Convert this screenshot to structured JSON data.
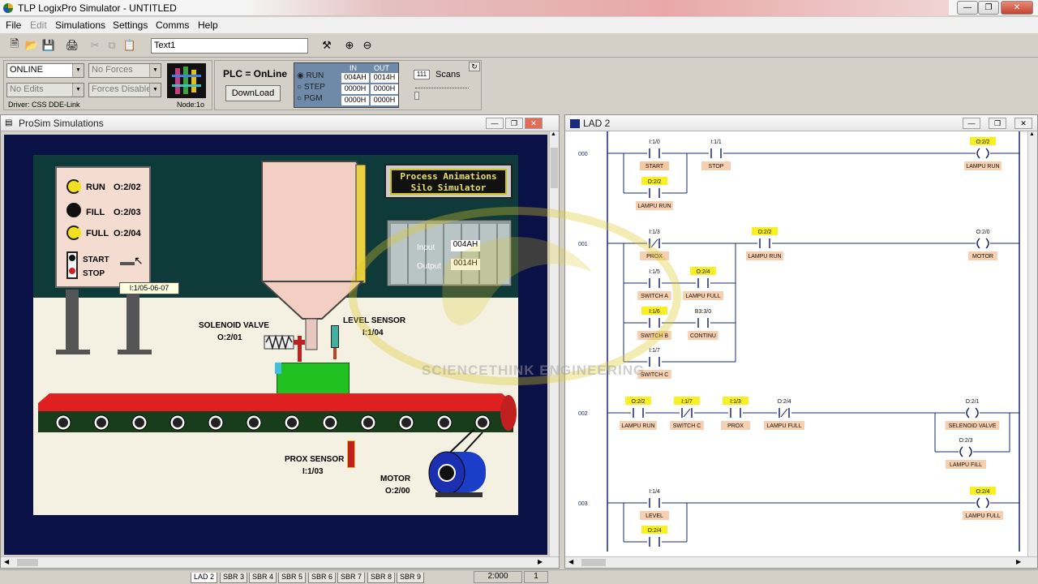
{
  "window": {
    "title": "TLP LogixPro Simulator  -  UNTITLED"
  },
  "menu": [
    "File",
    "Edit",
    "Simulations",
    "Settings",
    "Comms",
    "Help"
  ],
  "toolbar": {
    "text_field": "Text1"
  },
  "controls": {
    "mode": "ONLINE",
    "forces": "No Forces",
    "edits": "No Edits",
    "forces_state": "Forces Disabled",
    "driver": "Driver: CSS DDE-Link",
    "node": "Node:1o",
    "plc_status": "PLC = OnLine",
    "download": "DownLoad",
    "modes": [
      "RUN",
      "STEP",
      "PGM"
    ],
    "io_headers": [
      "IN",
      "OUT"
    ],
    "io_rows": [
      [
        "004AH",
        "0014H"
      ],
      [
        "0000H",
        "0000H"
      ],
      [
        "0000H",
        "0000H"
      ]
    ],
    "scans_value": "111",
    "scans_label": "Scans"
  },
  "prosim": {
    "title": "ProSim Simulations",
    "banner": [
      "Process Animations",
      "Silo Simulator"
    ],
    "plc_input_label": "Input",
    "plc_input": "004AH",
    "plc_output_label": "Output",
    "plc_output": "0014H",
    "lights": [
      {
        "label": "RUN",
        "addr": "O:2/02"
      },
      {
        "label": "FILL",
        "addr": "O:2/03"
      },
      {
        "label": "FULL",
        "addr": "O:2/04"
      }
    ],
    "start": "START",
    "stop": "STOP",
    "tooltip": "I:1/05-06-07",
    "solenoid": {
      "label": "SOLENOID VALVE",
      "addr": "O:2/01"
    },
    "level": {
      "label": "LEVEL SENSOR",
      "addr": "I:1/04"
    },
    "prox": {
      "label": "PROX SENSOR",
      "addr": "I:1/03"
    },
    "motor": {
      "label": "MOTOR",
      "addr": "O:2/00"
    },
    "watermark": "SCIENCETHINK ENGINEERING"
  },
  "lad": {
    "title": "LAD 2",
    "rungs": [
      "000",
      "001",
      "002",
      "003"
    ],
    "el": {
      "r0_start_addr": "I:1/0",
      "r0_start": "START",
      "r0_stop_addr": "I:1/1",
      "r0_stop": "STOP",
      "r0_coil_addr": "O:2/2",
      "r0_coil": "LAMPU RUN",
      "r0_br_addr": "O:2/2",
      "r0_br": "LAMPU RUN",
      "r1_prox_addr": "I:1/3",
      "r1_prox": "PROX",
      "r1_run_addr": "O:2/2",
      "r1_run": "LAMPU RUN",
      "r1_coil_addr": "O:2/0",
      "r1_coil": "MOTOR",
      "r1_swa_addr": "I:1/5",
      "r1_swa": "SWITCH A",
      "r1_full_addr": "O:2/4",
      "r1_full": "LAMPU FULL",
      "r1_swb_addr": "I:1/6",
      "r1_swb": "SWITCH B",
      "r1_cont_addr": "B3:3/0",
      "r1_cont": "CONTINU",
      "r1_swc_addr": "I:1/7",
      "r1_swc": "SWITCH C",
      "r2_run_addr": "O:2/2",
      "r2_run": "LAMPU RUN",
      "r2_swc_addr": "I:1/7",
      "r2_swc": "SWITCH C",
      "r2_prox_addr": "I:1/3",
      "r2_prox": "PROX",
      "r2_full_addr": "O:2/4",
      "r2_full": "LAMPU FULL",
      "r2_coil1_addr": "O:2/1",
      "r2_coil1": "SELENOID VALVE",
      "r2_coil2_addr": "O:2/3",
      "r2_coil2": "LAMPU FILL",
      "r3_level_addr": "I:1/4",
      "r3_level": "LEVEL",
      "r3_coil_addr": "O:2/4",
      "r3_coil": "LAMPU FULL",
      "r3_br_addr": "O:2/4"
    }
  },
  "status": {
    "tabs": [
      "LAD 2",
      "SBR 3",
      "SBR 4",
      "SBR 5",
      "SBR 6",
      "SBR 7",
      "SBR 8",
      "SBR 9"
    ],
    "ratio": "2:000",
    "page": "1"
  }
}
